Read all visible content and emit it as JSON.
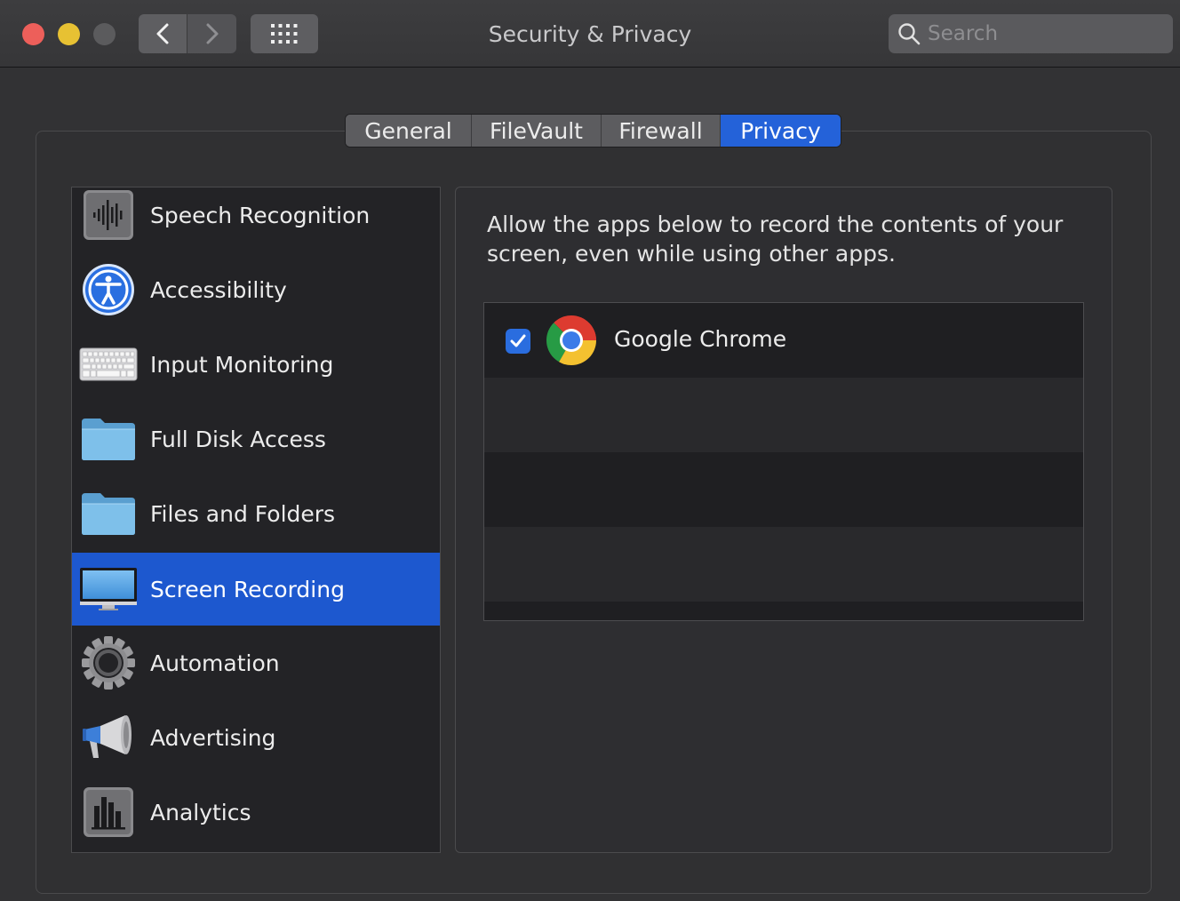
{
  "window": {
    "title": "Security & Privacy"
  },
  "search": {
    "placeholder": "Search"
  },
  "tabs": [
    {
      "label": "General"
    },
    {
      "label": "FileVault"
    },
    {
      "label": "Firewall"
    },
    {
      "label": "Privacy",
      "active": true
    }
  ],
  "sidebar": {
    "items": [
      {
        "label": "Speech Recognition",
        "icon": "waveform-icon"
      },
      {
        "label": "Accessibility",
        "icon": "accessibility-icon"
      },
      {
        "label": "Input Monitoring",
        "icon": "keyboard-icon"
      },
      {
        "label": "Full Disk Access",
        "icon": "folder-icon"
      },
      {
        "label": "Files and Folders",
        "icon": "folder-icon"
      },
      {
        "label": "Screen Recording",
        "icon": "display-icon",
        "selected": true
      },
      {
        "label": "Automation",
        "icon": "gear-icon"
      },
      {
        "label": "Advertising",
        "icon": "megaphone-icon"
      },
      {
        "label": "Analytics",
        "icon": "bar-chart-icon"
      }
    ]
  },
  "detail": {
    "description": "Allow the apps below to record the contents of your screen, even while using other apps.",
    "apps": [
      {
        "name": "Google Chrome",
        "checked": true,
        "icon": "chrome-icon"
      }
    ]
  },
  "colors": {
    "accent": "#2462d9",
    "selection": "#1d58cf",
    "close": "#ed5f5a",
    "minimize": "#e7c133"
  }
}
